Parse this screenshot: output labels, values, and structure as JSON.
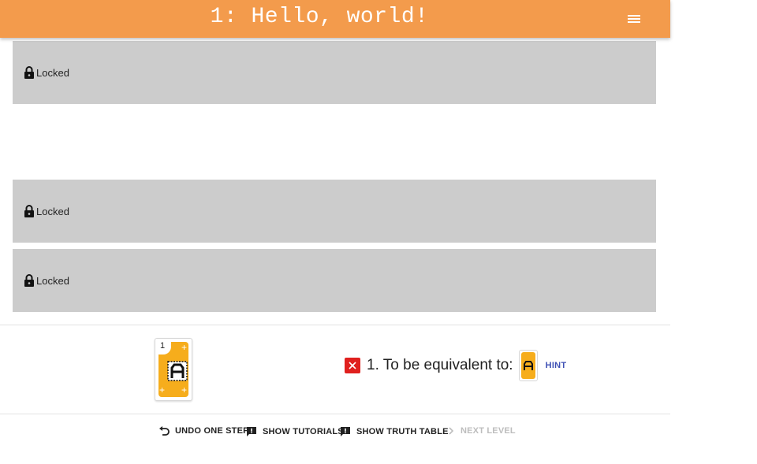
{
  "header": {
    "title": "1: Hello, world!",
    "menu_icon": "hamburger-menu-icon",
    "background_color": "#f39b4c"
  },
  "panels": [
    {
      "status": "Locked",
      "icon": "lock-icon"
    },
    {
      "status": "Locked",
      "icon": "lock-icon"
    },
    {
      "status": "Locked",
      "icon": "lock-icon"
    }
  ],
  "colors": {
    "panel_bg": "#cccccc",
    "card": "#f6ad1c",
    "error": "#e0201e",
    "hint": "#3f51b5"
  },
  "workspace": {
    "card": {
      "number": "1",
      "glyph": "A-glyph-icon"
    }
  },
  "goal": {
    "status_icon": "x-error-icon",
    "text": "1. To be equivalent to:",
    "hint_label": "HINT"
  },
  "toolbar": {
    "undo_label": "UNDO ONE STEP",
    "tutorials_label": "SHOW TUTORIALS",
    "truth_table_label": "SHOW TRUTH TABLE",
    "next_label": "NEXT LEVEL"
  }
}
